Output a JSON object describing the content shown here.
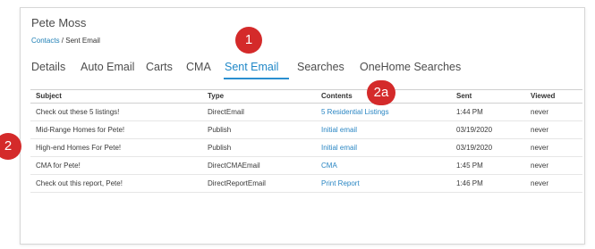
{
  "contact": {
    "name": "Pete Moss"
  },
  "breadcrumb": {
    "root": "Contacts",
    "separator": " / ",
    "current": "Sent Email"
  },
  "tabs": [
    {
      "label": "Details"
    },
    {
      "label": "Auto Email"
    },
    {
      "label": "Carts"
    },
    {
      "label": "CMA"
    },
    {
      "label": "Sent Email",
      "active": true
    },
    {
      "label": "Searches"
    },
    {
      "label": "OneHome Searches"
    }
  ],
  "table": {
    "columns": [
      "Subject",
      "Type",
      "Contents",
      "Sent",
      "Viewed"
    ],
    "rows": [
      {
        "subject": "Check out these 5 listings!",
        "type": "DirectEmail",
        "contents": "5 Residential Listings",
        "sent": "1:44 PM",
        "viewed": "never"
      },
      {
        "subject": "Mid-Range Homes for Pete!",
        "type": "Publish",
        "contents": "Initial email",
        "sent": "03/19/2020",
        "viewed": "never"
      },
      {
        "subject": "High-end Homes For Pete!",
        "type": "Publish",
        "contents": "Initial email",
        "sent": "03/19/2020",
        "viewed": "never"
      },
      {
        "subject": "CMA for Pete!",
        "type": "DirectCMAEmail",
        "contents": "CMA",
        "sent": "1:45 PM",
        "viewed": "never"
      },
      {
        "subject": "Check out this report, Pete!",
        "type": "DirectReportEmail",
        "contents": "Print Report",
        "sent": "1:46 PM",
        "viewed": "never"
      }
    ]
  },
  "callouts": {
    "one": "1",
    "two_a": "2a",
    "two": "2"
  },
  "colors": {
    "accent": "#1f87c7",
    "callout": "#d42a2a"
  }
}
